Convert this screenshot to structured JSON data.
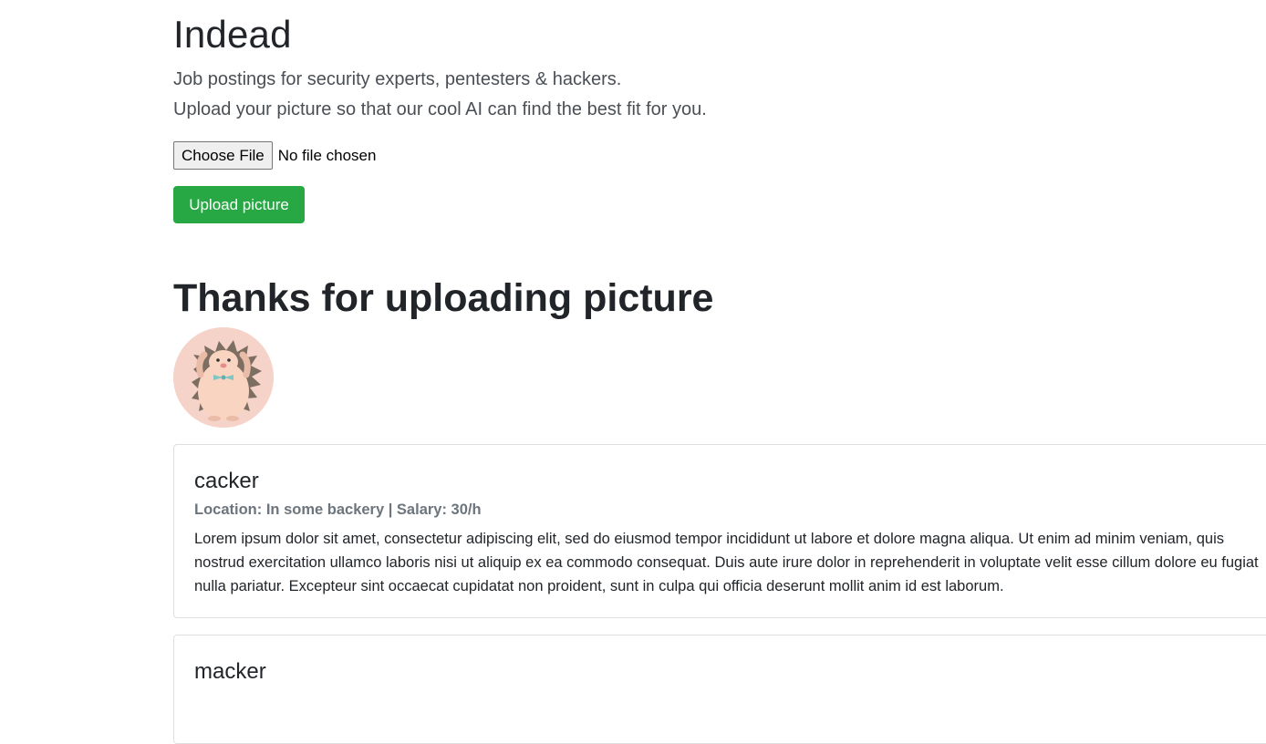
{
  "header": {
    "title": "Indead",
    "lead_line_1": "Job postings for security experts, pentesters & hackers.",
    "lead_line_2": "Upload your picture so that our cool AI can find the best fit for you."
  },
  "upload_form": {
    "choose_file_label": "Choose File",
    "file_status": "No file chosen",
    "submit_label": "Upload picture",
    "submit_color": "#28a745"
  },
  "result": {
    "heading": "Thanks for uploading picture",
    "avatar_icon": "hedgehog-avatar"
  },
  "jobs": [
    {
      "title": "cacker",
      "subtitle": "Location: In some backery | Salary: 30/h",
      "description": "Lorem ipsum dolor sit amet, consectetur adipiscing elit, sed do eiusmod tempor incididunt ut labore et dolore magna aliqua. Ut enim ad minim veniam, quis nostrud exercitation ullamco laboris nisi ut aliquip ex ea commodo consequat. Duis aute irure dolor in reprehenderit in voluptate velit esse cillum dolore eu fugiat nulla pariatur. Excepteur sint occaecat cupidatat non proident, sunt in culpa qui officia deserunt mollit anim id est laborum."
    },
    {
      "title": "macker"
    }
  ]
}
